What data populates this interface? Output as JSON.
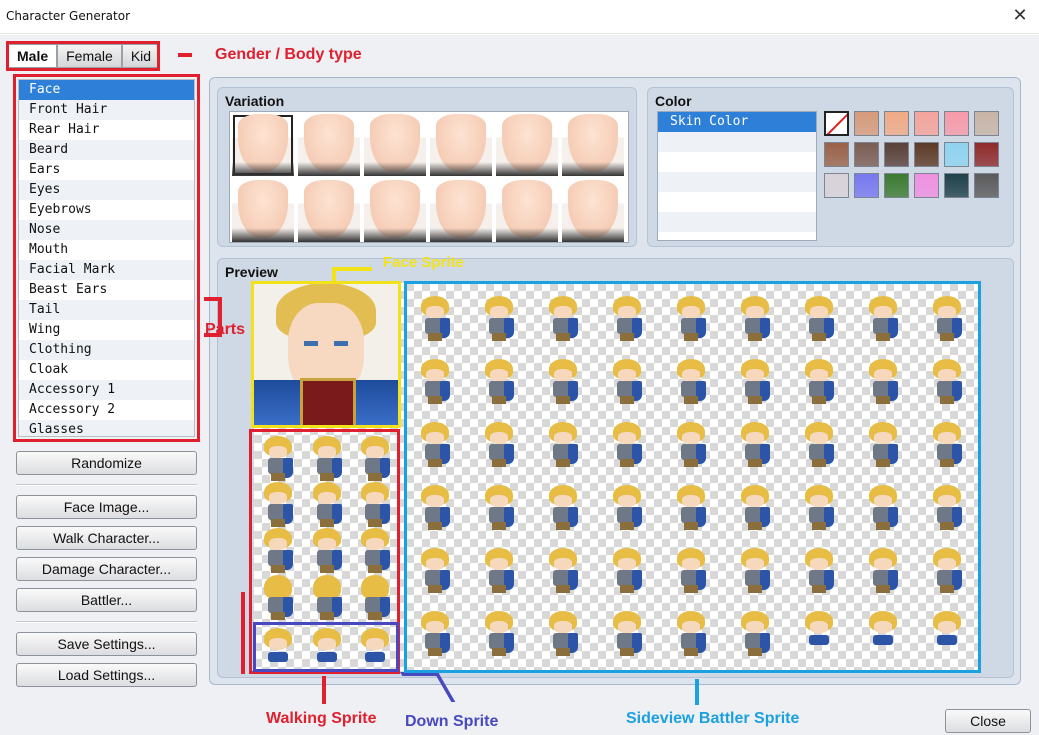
{
  "window": {
    "title": "Character Generator",
    "close_glyph": "✕"
  },
  "gender_tabs": [
    {
      "label": "Male",
      "active": true
    },
    {
      "label": "Female",
      "active": false
    },
    {
      "label": "Kid",
      "active": false
    }
  ],
  "parts": {
    "selected_index": 0,
    "items": [
      "Face",
      "Front Hair",
      "Rear Hair",
      "Beard",
      "Ears",
      "Eyes",
      "Eyebrows",
      "Nose",
      "Mouth",
      "Facial Mark",
      "Beast Ears",
      "Tail",
      "Wing",
      "Clothing",
      "Cloak",
      "Accessory 1",
      "Accessory 2",
      "Glasses"
    ]
  },
  "buttons": {
    "randomize": "Randomize",
    "face_image": "Face Image...",
    "walk_character": "Walk Character...",
    "damage_character": "Damage Character...",
    "battler": "Battler...",
    "save_settings": "Save Settings...",
    "load_settings": "Load Settings...",
    "close": "Close"
  },
  "variation": {
    "title": "Variation",
    "selected_index": 0,
    "count": 12
  },
  "color": {
    "title": "Color",
    "items": [
      "Skin Color",
      "",
      "",
      "",
      "",
      ""
    ],
    "selected_index": 0,
    "swatches": [
      "none",
      "#d79b7a",
      "#f1aa86",
      "#f5a39b",
      "#f79aa8",
      "#c9b5a7",
      "#9a6248",
      "#7b5d52",
      "#5a4038",
      "#5c3a26",
      "#8fd4f0",
      "#8f2a2a",
      "#d9d2d8",
      "#7878f0",
      "#3b7a30",
      "#f090e0",
      "#20404a",
      "#5a5a5a"
    ]
  },
  "preview": {
    "title": "Preview"
  },
  "annotations": {
    "gender": {
      "label": "Gender / Body type",
      "color": "#e0202e"
    },
    "parts": {
      "label": "Parts",
      "color": "#e0202e"
    },
    "face_sprite": {
      "label": "Face Sprite",
      "color": "#f2e21a"
    },
    "walking_sprite": {
      "label": "Walking Sprite",
      "color": "#e0202e"
    },
    "down_sprite": {
      "label": "Down Sprite",
      "color": "#4848c0"
    },
    "sideview": {
      "label": "Sideview Battler Sprite",
      "color": "#1ba0e0"
    }
  }
}
